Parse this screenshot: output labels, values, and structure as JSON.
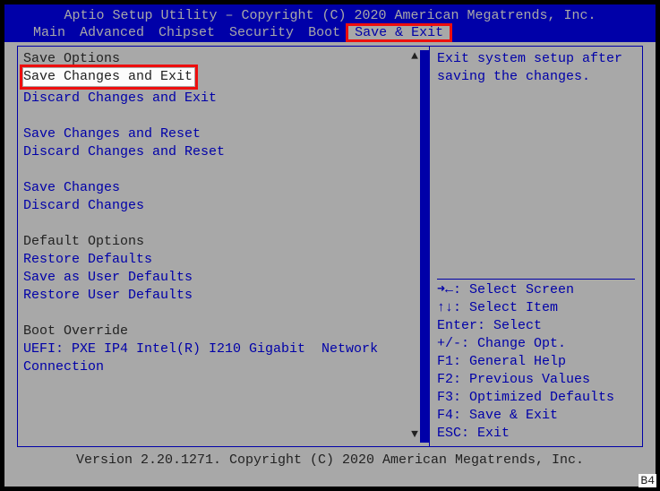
{
  "header": {
    "title": "Aptio Setup Utility – Copyright (C) 2020 American Megatrends, Inc."
  },
  "tabs": {
    "items": [
      "Main",
      "Advanced",
      "Chipset",
      "Security",
      "Boot",
      "Save & Exit"
    ],
    "active_index": 5
  },
  "left": {
    "groups": [
      {
        "heading": "Save Options",
        "items": [
          {
            "label": "Save Changes and Exit",
            "selected": true
          },
          {
            "label": "Discard Changes and Exit"
          }
        ]
      },
      {
        "heading": "",
        "items": [
          {
            "label": "Save Changes and Reset"
          },
          {
            "label": "Discard Changes and Reset"
          }
        ]
      },
      {
        "heading": "",
        "items": [
          {
            "label": "Save Changes"
          },
          {
            "label": "Discard Changes"
          }
        ]
      },
      {
        "heading": "Default Options",
        "items": [
          {
            "label": "Restore Defaults"
          },
          {
            "label": "Save as User Defaults"
          },
          {
            "label": "Restore User Defaults"
          }
        ]
      },
      {
        "heading": "Boot Override",
        "items": [
          {
            "label": "UEFI: PXE IP4 Intel(R) I210 Gigabit  Network"
          },
          {
            "label": "Connection"
          }
        ]
      }
    ]
  },
  "right": {
    "help": [
      "Exit system setup after",
      "saving the changes."
    ],
    "keys": [
      "➜←: Select Screen",
      "↑↓: Select Item",
      "Enter: Select",
      "+/-: Change Opt.",
      "F1: General Help",
      "F2: Previous Values",
      "F3: Optimized Defaults",
      "F4: Save & Exit",
      "ESC: Exit"
    ]
  },
  "footer": {
    "version": "Version 2.20.1271. Copyright (C) 2020 American Megatrends, Inc."
  },
  "corner": "B4"
}
